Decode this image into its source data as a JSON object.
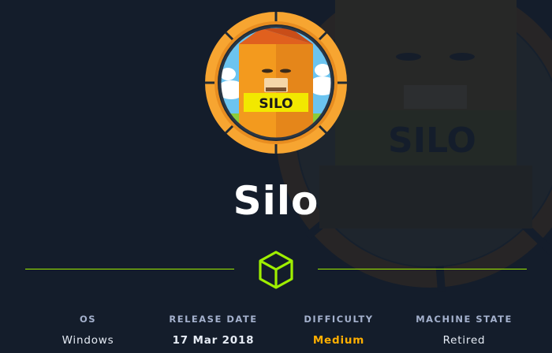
{
  "machine": {
    "name": "Silo",
    "logo_text": "SILO"
  },
  "stats": [
    {
      "label": "OS",
      "value": "Windows"
    },
    {
      "label": "RELEASE DATE",
      "value": "17 Mar 2018"
    },
    {
      "label": "DIFFICULTY",
      "value": "Medium"
    },
    {
      "label": "MACHINE STATE",
      "value": "Retired"
    }
  ],
  "colors": {
    "background": "#141d2b",
    "accent_green": "#9fef00",
    "difficulty_medium": "#ffaf00",
    "label_gray": "#a4b1cd",
    "badge_orange": "#f7a531"
  },
  "icons": {
    "divider_icon": "cube-icon"
  }
}
